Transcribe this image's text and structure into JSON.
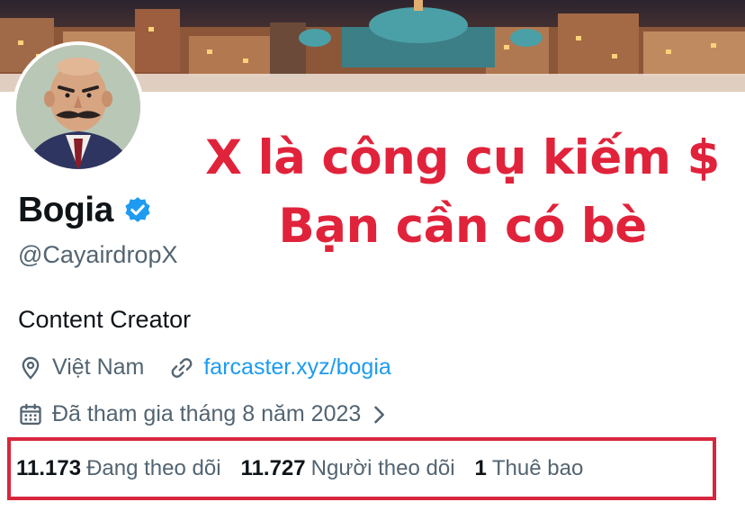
{
  "profile": {
    "display_name": "Bogia",
    "handle": "@CayairdropX",
    "bio": "Content Creator",
    "location": "Việt Nam",
    "website": "farcaster.xyz/bogia",
    "joined": "Đã tham gia tháng 8 năm 2023",
    "verified": true,
    "verified_color": "#1d9bf0"
  },
  "promo": {
    "line1": "X là công cụ kiếm $",
    "line2": "Bạn cần có bè",
    "color": "#e0233b"
  },
  "stats": {
    "following_count": "11.173",
    "following_label": "Đang theo dõi",
    "followers_count": "11.727",
    "followers_label": "Người theo dõi",
    "subscriptions_count": "1",
    "subscriptions_label": "Thuê bao",
    "highlight_color": "#d7263d"
  },
  "icons": {
    "verified": "verified-badge-icon",
    "location": "location-pin-icon",
    "link": "link-icon",
    "calendar": "calendar-icon",
    "chevron": "chevron-right-icon"
  }
}
